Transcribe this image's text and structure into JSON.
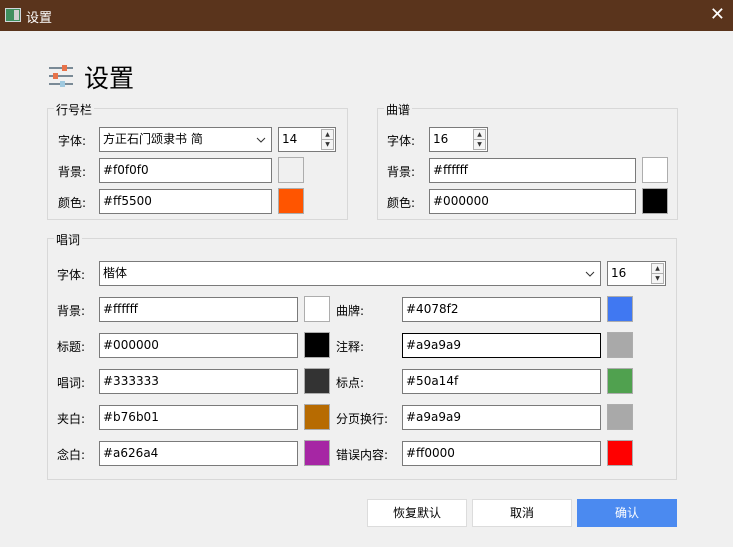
{
  "window": {
    "title": "设置"
  },
  "heading": "设置",
  "line_bar": {
    "legend": "行号栏",
    "font_label": "字体:",
    "font_value": "方正石门颂隶书 简",
    "font_size": "14",
    "bg_label": "背景:",
    "bg_value": "#f0f0f0",
    "color_label": "颜色:",
    "color_value": "#ff5500"
  },
  "score": {
    "legend": "曲谱",
    "font_label": "字体:",
    "font_size": "16",
    "bg_label": "背景:",
    "bg_value": "#ffffff",
    "color_label": "颜色:",
    "color_value": "#000000"
  },
  "lyrics": {
    "legend": "唱词",
    "font_label": "字体:",
    "font_value": "楷体",
    "font_size": "16",
    "left": [
      {
        "label": "背景:",
        "value": "#ffffff"
      },
      {
        "label": "标题:",
        "value": "#000000"
      },
      {
        "label": "唱词:",
        "value": "#333333"
      },
      {
        "label": "夹白:",
        "value": "#b76b01"
      },
      {
        "label": "念白:",
        "value": "#a626a4"
      }
    ],
    "right": [
      {
        "label": "曲牌:",
        "value": "#4078f2"
      },
      {
        "label": "注释:",
        "value": "#a9a9a9"
      },
      {
        "label": "标点:",
        "value": "#50a14f"
      },
      {
        "label": "分页换行:",
        "value": "#a9a9a9"
      },
      {
        "label": "错误内容:",
        "value": "#ff0000"
      }
    ]
  },
  "buttons": {
    "restore": "恢复默认",
    "cancel": "取消",
    "ok": "确认"
  }
}
